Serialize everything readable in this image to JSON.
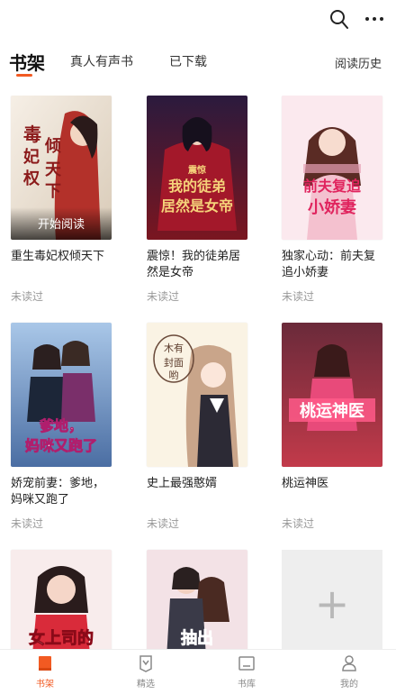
{
  "top_tabs": {
    "bookshelf": "书架",
    "audio": "真人有声书",
    "downloaded": "已下载",
    "history": "阅读历史"
  },
  "accent_color": "#f25a22",
  "books": [
    {
      "title": "重生毒妃权倾天下",
      "status": "未读过",
      "cover_text": "毒妃权倾天下",
      "overlay": "开始阅读"
    },
    {
      "title": "震惊！我的徒弟居然是女帝",
      "status": "未读过",
      "cover_text": "震惊 我的徒弟居然是女帝"
    },
    {
      "title": "独家心动：前夫复追小娇妻",
      "status": "未读过",
      "cover_text": "前夫复追小娇妻"
    },
    {
      "title": "娇宠前妻：爹地，妈咪又跑了",
      "status": "未读过",
      "cover_text": "爹地，妈咪又跑了"
    },
    {
      "title": "史上最强憨婿",
      "status": "未读过",
      "cover_text": "木有封面哟"
    },
    {
      "title": "桃运神医",
      "status": "未读过",
      "cover_text": "桃运神医"
    },
    {
      "title": "",
      "status": "",
      "cover_text": "女上司的"
    },
    {
      "title": "",
      "status": "",
      "cover_text": "抽出"
    }
  ],
  "add_tile": {
    "icon": "plus-icon"
  },
  "bottom_nav": [
    {
      "label": "书架",
      "icon": "bookshelf-icon",
      "active": true
    },
    {
      "label": "精选",
      "icon": "featured-icon",
      "active": false
    },
    {
      "label": "书库",
      "icon": "library-icon",
      "active": false
    },
    {
      "label": "我的",
      "icon": "profile-icon",
      "active": false
    }
  ]
}
